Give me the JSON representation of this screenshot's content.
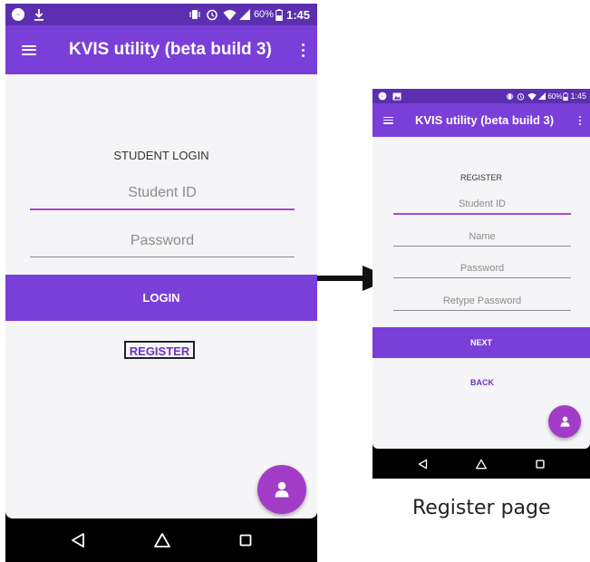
{
  "login_screen": {
    "status_bar": {
      "battery": "60%",
      "time": "1:45"
    },
    "app_bar": {
      "title": "KVIS utility (beta build 3)"
    },
    "heading": "STUDENT LOGIN",
    "student_id_placeholder": "Student ID",
    "password_placeholder": "Password",
    "login_button": "LOGIN",
    "register_link": "REGISTER"
  },
  "register_screen": {
    "status_bar": {
      "battery": "60%",
      "time": "1:45"
    },
    "app_bar": {
      "title": "KVIS utility (beta build 3)"
    },
    "heading": "REGISTER",
    "student_id_placeholder": "Student ID",
    "name_placeholder": "Name",
    "password_placeholder": "Password",
    "retype_password_placeholder": "Retype Password",
    "next_button": "NEXT",
    "back_link": "BACK"
  },
  "caption": "Register page",
  "colors": {
    "status_bar": "#5b2fb0",
    "app_bar": "#7a3fd8",
    "primary_button": "#7a3fd8",
    "fab": "#a23cc7",
    "active_underline": "#a64cc9",
    "register_outline": "#222222"
  },
  "icons": [
    "messenger-icon",
    "download-icon",
    "vibrate-icon",
    "alarm-icon",
    "wifi-icon",
    "signal-icon",
    "battery-icon",
    "image-icon",
    "hamburger-menu-icon",
    "more-vert-icon",
    "person-icon",
    "back-triangle-icon",
    "home-icon",
    "recents-icon",
    "right-arrow"
  ]
}
